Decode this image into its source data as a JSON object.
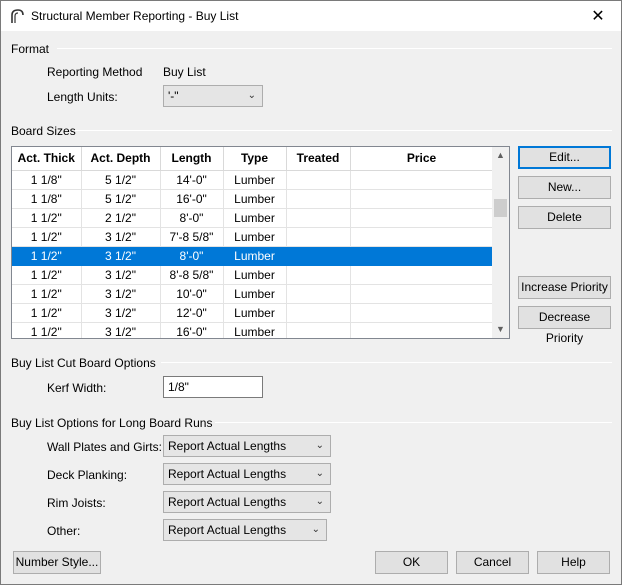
{
  "window": {
    "title": "Structural Member Reporting - Buy List",
    "close_glyph": "✕"
  },
  "format": {
    "section_label": "Format",
    "reporting_method_label": "Reporting Method",
    "reporting_method_value": "Buy List",
    "length_units_label": "Length Units:",
    "length_units_value": "'-\""
  },
  "board_sizes": {
    "section_label": "Board Sizes",
    "columns": [
      "Act. Thick",
      "Act. Depth",
      "Length",
      "Type",
      "Treated",
      "Price"
    ],
    "rows": [
      [
        "1 1/8\"",
        "5 1/2\"",
        "14'-0\"",
        "Lumber",
        "",
        ""
      ],
      [
        "1 1/8\"",
        "5 1/2\"",
        "16'-0\"",
        "Lumber",
        "",
        ""
      ],
      [
        "1 1/2\"",
        "2 1/2\"",
        "8'-0\"",
        "Lumber",
        "",
        ""
      ],
      [
        "1 1/2\"",
        "3 1/2\"",
        "7'-8 5/8\"",
        "Lumber",
        "",
        ""
      ],
      [
        "1 1/2\"",
        "3 1/2\"",
        "8'-0\"",
        "Lumber",
        "",
        ""
      ],
      [
        "1 1/2\"",
        "3 1/2\"",
        "8'-8 5/8\"",
        "Lumber",
        "",
        ""
      ],
      [
        "1 1/2\"",
        "3 1/2\"",
        "10'-0\"",
        "Lumber",
        "",
        ""
      ],
      [
        "1 1/2\"",
        "3 1/2\"",
        "12'-0\"",
        "Lumber",
        "",
        ""
      ],
      [
        "1 1/2\"",
        "3 1/2\"",
        "16'-0\"",
        "Lumber",
        "",
        ""
      ]
    ],
    "selected_row": 4,
    "buttons": {
      "edit": "Edit...",
      "new": "New...",
      "delete": "Delete",
      "increase_priority": "Increase Priority",
      "decrease_priority": "Decrease Priority"
    }
  },
  "cut_options": {
    "section_label": "Buy List Cut Board Options",
    "kerf_label": "Kerf Width:",
    "kerf_value": "1/8\""
  },
  "long_runs": {
    "section_label": "Buy List Options for Long Board Runs",
    "wall_plates_label": "Wall Plates and Girts:",
    "wall_plates_value": "Report Actual Lengths",
    "deck_planking_label": "Deck Planking:",
    "deck_planking_value": "Report Actual Lengths",
    "rim_joists_label": "Rim Joists:",
    "rim_joists_value": "Report Actual Lengths",
    "other_label": "Other:",
    "other_value": "Report Actual Lengths"
  },
  "footer": {
    "number_style": "Number Style...",
    "ok": "OK",
    "cancel": "Cancel",
    "help": "Help"
  },
  "colors": {
    "selection": "#0078d7",
    "dialog_bg": "#f0f0f0"
  }
}
